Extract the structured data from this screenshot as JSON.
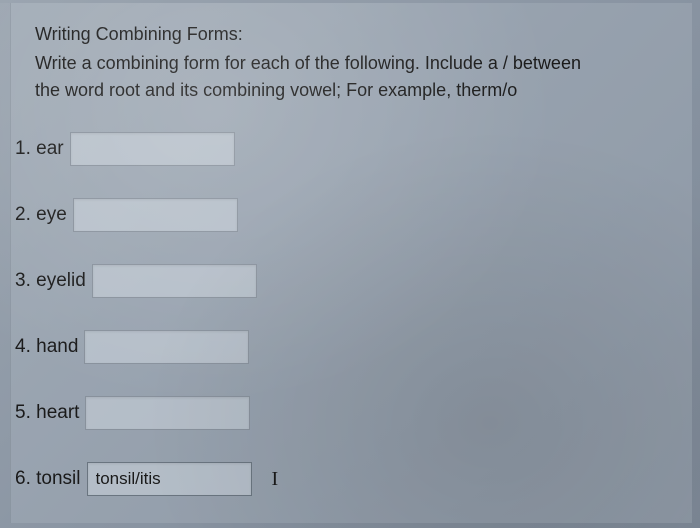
{
  "header": {
    "title": "Writing Combining Forms:",
    "instruction_line1": "Write a combining form for each of the following.  Include a / between",
    "instruction_line2": "the word root and its combining vowel; For example, therm/o"
  },
  "questions": [
    {
      "number": "1.",
      "term": "ear",
      "value": ""
    },
    {
      "number": "2.",
      "term": "eye",
      "value": ""
    },
    {
      "number": "3.",
      "term": "eyelid",
      "value": ""
    },
    {
      "number": "4.",
      "term": "hand",
      "value": ""
    },
    {
      "number": "5.",
      "term": "heart",
      "value": ""
    },
    {
      "number": "6.",
      "term": "tonsil",
      "value": "tonsil/itis"
    }
  ],
  "cursor_symbol": "I"
}
